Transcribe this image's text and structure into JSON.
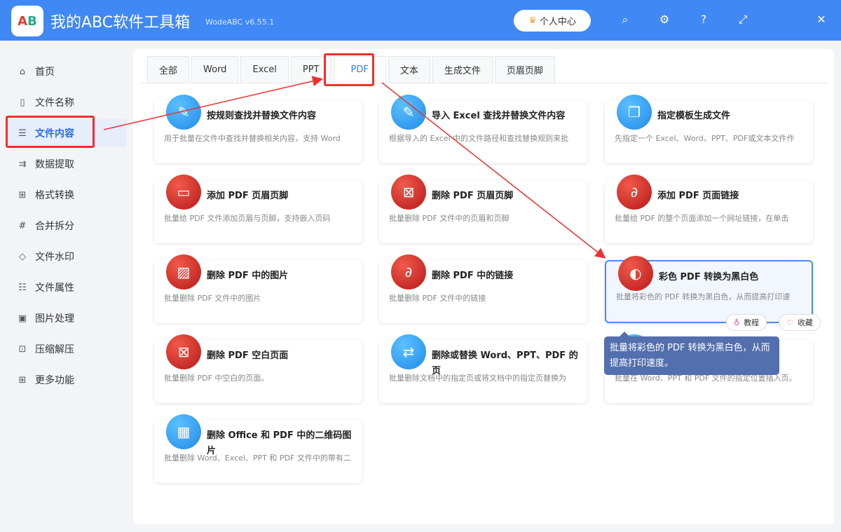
{
  "app": {
    "title": "我的ABC软件工具箱",
    "version": "WodeABC v6.55.1",
    "logo_text": "AB",
    "user_center": "个人中心"
  },
  "sidebar": {
    "items": [
      {
        "label": "首页",
        "icon": "⌂"
      },
      {
        "label": "文件名称",
        "icon": "▯"
      },
      {
        "label": "文件内容",
        "icon": "☰"
      },
      {
        "label": "数据提取",
        "icon": "⇉"
      },
      {
        "label": "格式转换",
        "icon": "⊞"
      },
      {
        "label": "合并拆分",
        "icon": "#"
      },
      {
        "label": "文件水印",
        "icon": "◇"
      },
      {
        "label": "文件属性",
        "icon": "☷"
      },
      {
        "label": "图片处理",
        "icon": "▣"
      },
      {
        "label": "压缩解压",
        "icon": "⊡"
      },
      {
        "label": "更多功能",
        "icon": "⊞"
      }
    ]
  },
  "tabs": [
    "全部",
    "Word",
    "Excel",
    "PPT",
    "PDF",
    "文本",
    "生成文件",
    "页眉页脚"
  ],
  "cards": [
    {
      "title": "按规则查找并替换文件内容",
      "desc": "用于批量在文件中查找并替换相关内容，支持 Word",
      "color": "blue",
      "icon": "✎"
    },
    {
      "title": "导入 Excel 查找并替换文件内容",
      "desc": "根据导入的 Excel 中的文件路径和查找替换规则来批",
      "color": "blue",
      "icon": "✎"
    },
    {
      "title": "指定模板生成文件",
      "desc": "先指定一个 Excel、Word、PPT、PDF或文本文件作",
      "color": "blue",
      "icon": "❐"
    },
    {
      "title": "添加 PDF 页眉页脚",
      "desc": "批量给 PDF 文件添加页眉与页脚，支持嵌入页码",
      "color": "red",
      "icon": "▭"
    },
    {
      "title": "删除 PDF 页眉页脚",
      "desc": "批量删除 PDF 文件中的页眉和页脚",
      "color": "red",
      "icon": "⊠"
    },
    {
      "title": "添加 PDF 页面链接",
      "desc": "批量给 PDF 的整个页面添加一个网址链接，在单击",
      "color": "red",
      "icon": "∂"
    },
    {
      "title": "删除 PDF 中的图片",
      "desc": "批量删除 PDF 文件中的图片",
      "color": "red",
      "icon": "▨"
    },
    {
      "title": "删除 PDF 中的链接",
      "desc": "批量删除 PDF 文件中的链接",
      "color": "red",
      "icon": "∂"
    },
    {
      "title": "彩色 PDF 转换为黑白色",
      "desc": "批量将彩色的 PDF 转换为黑白色，从而提高打印速",
      "color": "red",
      "icon": "◐"
    },
    {
      "title": "删除 PDF 空白页面",
      "desc": "批量删除 PDF 中空白的页面。",
      "color": "red",
      "icon": "⊠"
    },
    {
      "title": "删除或替换 Word、PPT、PDF 的页",
      "desc": "批量删除文档中的指定页或将文档中的指定页替换为",
      "color": "blue",
      "icon": "⇄"
    },
    {
      "title": "在指定位置",
      "desc": "批量在 Word、PPT 和 PDF 文件的指定位置插入页。",
      "color": "blue",
      "icon": "+"
    },
    {
      "title": "删除 Office 和 PDF 中的二维码图片",
      "desc": "批量删除 Word、Excel、PPT 和 PDF 文件中的带有二",
      "color": "blue",
      "icon": "▦"
    }
  ],
  "hover_actions": {
    "tutorial": "教程",
    "favorite": "收藏"
  },
  "tooltip": "批量将彩色的 PDF 转换为黑白色，从而提高打印速度。"
}
